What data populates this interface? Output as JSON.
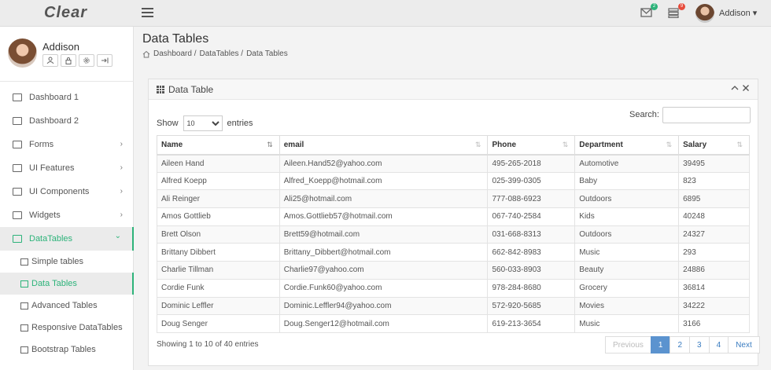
{
  "app": {
    "logo": "Clear",
    "user": "Addison ▾",
    "mail_badge": "2",
    "notif_badge": "9",
    "accent": "#2db37a",
    "link": "#3a7cc0"
  },
  "sidebar": {
    "profile_name": "Addison",
    "profile_buttons": [
      "user-icon",
      "lock-icon",
      "gear-icon",
      "logout-icon"
    ],
    "items": [
      {
        "label": "Dashboard 1",
        "icon": "monitor-icon",
        "chevron": ""
      },
      {
        "label": "Dashboard 2",
        "icon": "monitor-icon",
        "chevron": ""
      },
      {
        "label": "Forms",
        "icon": "checkbox-icon",
        "chevron": "›"
      },
      {
        "label": "UI Features",
        "icon": "monitor-icon",
        "chevron": "›"
      },
      {
        "label": "UI Components",
        "icon": "briefcase-icon",
        "chevron": "›"
      },
      {
        "label": "Widgets",
        "icon": "widget-icon",
        "chevron": "›"
      },
      {
        "label": "DataTables",
        "icon": "table-icon",
        "chevron": "⌄"
      }
    ],
    "subitems": [
      {
        "label": "Simple tables",
        "icon": "table-icon"
      },
      {
        "label": "Data Tables",
        "icon": "database-icon"
      },
      {
        "label": "Advanced Tables",
        "icon": "grid-icon"
      },
      {
        "label": "Responsive DataTables",
        "icon": "table-icon"
      },
      {
        "label": "Bootstrap Tables",
        "icon": "grid-icon"
      }
    ]
  },
  "header": {
    "title": "Data Tables",
    "breadcrumb": [
      "Dashboard /",
      "DataTables /",
      "Data Tables"
    ]
  },
  "panel": {
    "title": "Data Table",
    "show_label": "Show",
    "page_size": "10",
    "entries_label": "entries",
    "search_label": "Search:",
    "search_value": "",
    "columns": [
      "Name",
      "email",
      "Phone",
      "Department",
      "Salary"
    ],
    "rows": [
      [
        "Aileen Hand",
        "Aileen.Hand52@yahoo.com",
        "495-265-2018",
        "Automotive",
        "39495"
      ],
      [
        "Alfred Koepp",
        "Alfred_Koepp@hotmail.com",
        "025-399-0305",
        "Baby",
        "823"
      ],
      [
        "Ali Reinger",
        "Ali25@hotmail.com",
        "777-088-6923",
        "Outdoors",
        "6895"
      ],
      [
        "Amos Gottlieb",
        "Amos.Gottlieb57@hotmail.com",
        "067-740-2584",
        "Kids",
        "40248"
      ],
      [
        "Brett Olson",
        "Brett59@hotmail.com",
        "031-668-8313",
        "Outdoors",
        "24327"
      ],
      [
        "Brittany Dibbert",
        "Brittany_Dibbert@hotmail.com",
        "662-842-8983",
        "Music",
        "293"
      ],
      [
        "Charlie Tillman",
        "Charlie97@yahoo.com",
        "560-033-8903",
        "Beauty",
        "24886"
      ],
      [
        "Cordie Funk",
        "Cordie.Funk60@yahoo.com",
        "978-284-8680",
        "Grocery",
        "36814"
      ],
      [
        "Dominic Leffler",
        "Dominic.Leffler94@yahoo.com",
        "572-920-5685",
        "Movies",
        "34222"
      ],
      [
        "Doug Senger",
        "Doug.Senger12@hotmail.com",
        "619-213-3654",
        "Music",
        "3166"
      ]
    ],
    "info": "Showing 1 to 10 of 40 entries",
    "pager": [
      "Previous",
      "1",
      "2",
      "3",
      "4",
      "Next"
    ]
  }
}
